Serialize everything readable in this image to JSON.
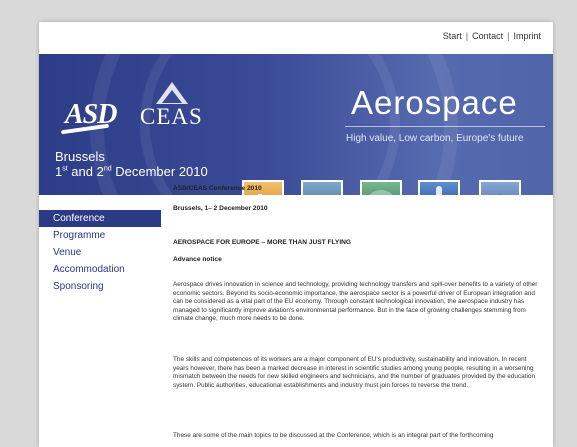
{
  "header_nav": {
    "start": "Start",
    "contact": "Contact",
    "imprint": "Imprint",
    "separator": "|"
  },
  "banner": {
    "asd_logo": "ASD",
    "ceas_logo": "CEAS",
    "city": "Brussels",
    "dates": "1st and 2nd December 2010",
    "title": "Aerospace",
    "tagline": "High value, Low carbon, Europe's future",
    "thumbnails": [
      "airliner-photo",
      "helicopter-photo",
      "cockpit-photo",
      "rocket-photo",
      "fighter-jet-photo"
    ]
  },
  "sidebar": {
    "items": [
      {
        "label": "Conference",
        "active": true
      },
      {
        "label": "Programme"
      },
      {
        "label": "Venue"
      },
      {
        "label": "Accommodation"
      },
      {
        "label": "Sponsoring"
      }
    ]
  },
  "content": {
    "conference_title": "ASD/CEAS Conference 2010",
    "location_date": "Brussels, 1– 2 December 2010",
    "section_heading": "AEROSPACE FOR EUROPE – MORE THAN JUST FLYING",
    "advance_notice": "Advance notice",
    "para1": "Aerospace drives innovation in science and technology, providing technology transfers and spill-over benefits to a variety of other economic sectors. Beyond its socio-economic importance, the aerospace sector is a powerful driver of European integration and can be considered as a vital part of the EU economy. Through constant technological innovation, the aerospace industry has managed to significantly improve aviation's environmental performance. But in the face of growing challenges stemming from climate change, much more needs to be done.",
    "para2": "The skills and competences of its workers are a major component of EU's productivity, sustainability and innovation. In recent years however, there has been a marked decrease in interest in scientific studies among young people, resulting in a worsening mismatch between the needs for new skilled engineers and technicians, and the number of graduates provided by the education system. Public authorities, educational establishments and industry must join forces to reverse the trend.",
    "para3": "These are some of the main topics to be discussed at the Conference, which is an integral part of the forthcoming"
  },
  "colors": {
    "brand_blue": "#2b3a84",
    "nav_text": "#28368a",
    "background": "#d9d9d9"
  }
}
